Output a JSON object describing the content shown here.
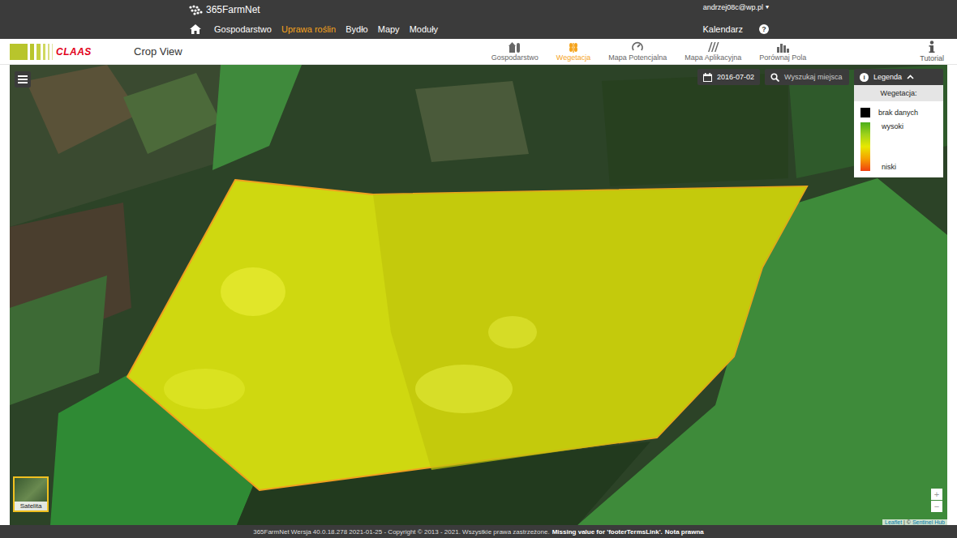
{
  "header": {
    "logo": "365FarmNet",
    "user": "andrzej08c@wp.pl",
    "user_caret": "▾",
    "nav": [
      {
        "label": "Gospodarstwo",
        "selected": false
      },
      {
        "label": "Uprawa roślin",
        "selected": true
      },
      {
        "label": "Bydło",
        "selected": false
      },
      {
        "label": "Mapy",
        "selected": false
      },
      {
        "label": "Moduły",
        "selected": false
      }
    ],
    "calendar": "Kalendarz",
    "help": "?"
  },
  "app_bar": {
    "brand": "CLAAS",
    "title": "Crop View",
    "tabs": [
      {
        "label": "Gospodarstwo",
        "selected": false
      },
      {
        "label": "Wegetacja",
        "selected": true
      },
      {
        "label": "Mapa Potencjalna",
        "selected": false
      },
      {
        "label": "Mapa Aplikacyjna",
        "selected": false
      },
      {
        "label": "Porównaj Pola",
        "selected": false
      }
    ],
    "tutorial": "Tutorial"
  },
  "map": {
    "date": "2016-07-02",
    "search_placeholder": "Wyszukaj miejsca",
    "legend": {
      "toggle": "Legenda",
      "expanded": true,
      "heading": "Wegetacja:",
      "no_data": "brak danych",
      "high": "wysoki",
      "low": "niski"
    },
    "basemap": "Satelita",
    "zoom_in": "+",
    "zoom_out": "−",
    "attribution": {
      "first": "Leaflet",
      "separator": " | © ",
      "second": "Sentinel Hub"
    }
  },
  "footer": [
    {
      "text": "365FarmNet Wersja 40.0.18.278 2021-01-25 - Copyright © 2013 - 2021. Wszystkie prawa zastrzeżone.",
      "bold": false
    },
    {
      "text": "Missing value for 'footerTermsLink'.",
      "bold": true
    },
    {
      "text": "Nota prawna",
      "bold": true
    }
  ]
}
